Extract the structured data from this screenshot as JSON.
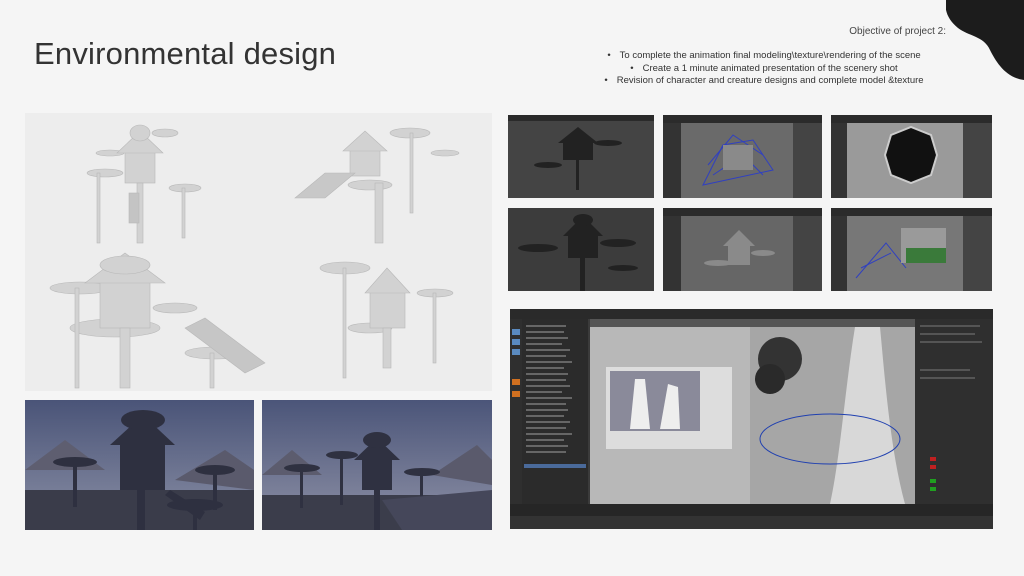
{
  "slide": {
    "title": "Environmental design",
    "objective_heading": "Objective of project 2:",
    "objectives": [
      "To complete the animation final modeling\\texture\\rendering of the scene",
      "Create a 1 minute animated presentation of the scenery shot",
      "Revision of character and creature designs and complete model &texture"
    ]
  },
  "colors": {
    "background": "#f5f5f5",
    "title_text": "#333333",
    "blob": "#1c1c1c",
    "render_sky": "#5c6890",
    "maya_dark": "#3b3b3b"
  },
  "icons": {
    "corner": "dark-blob-shape"
  }
}
